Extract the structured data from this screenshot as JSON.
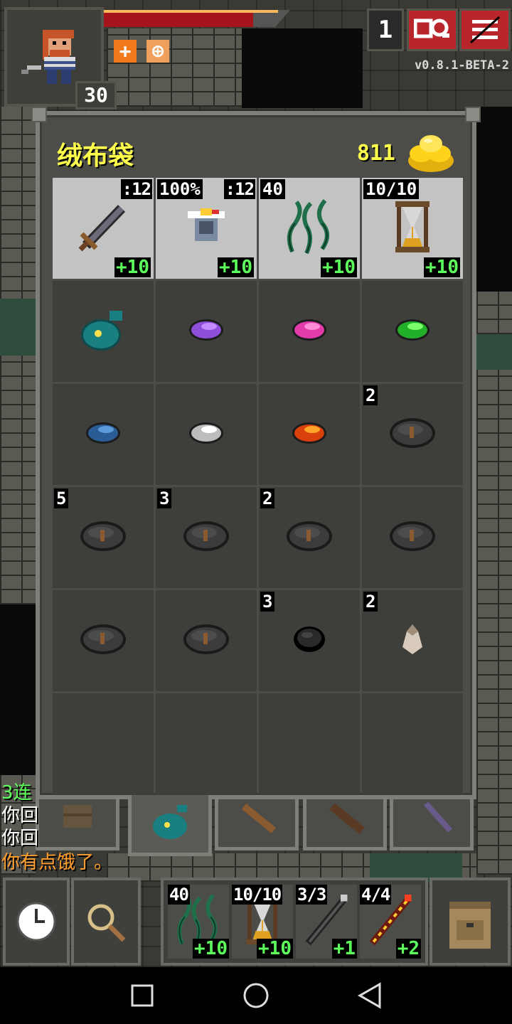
{
  "hud": {
    "depth": "30",
    "level_count": "1",
    "version": "v0.8.1-BETA-2",
    "buffs": [
      "plus-buff",
      "target-buff"
    ]
  },
  "bag": {
    "title": "绒布袋",
    "gold": "811",
    "slots": [
      {
        "icon": "sword",
        "tr": ":12",
        "br": "+10",
        "equipped": true
      },
      {
        "icon": "armor",
        "tl": "100%",
        "tr": ":12",
        "br": "+10",
        "equipped": true
      },
      {
        "icon": "vine-artifact",
        "tl": "40",
        "br": "+10",
        "equipped": true
      },
      {
        "icon": "hourglass",
        "tl": "10/10",
        "br": "+10",
        "equipped": true
      },
      {
        "icon": "velvet-pouch"
      },
      {
        "icon": "purple-seed"
      },
      {
        "icon": "pink-seed"
      },
      {
        "icon": "green-seed"
      },
      {
        "icon": "blue-seed"
      },
      {
        "icon": "white-seed"
      },
      {
        "icon": "orange-seed"
      },
      {
        "icon": "runestone",
        "tl": "2"
      },
      {
        "icon": "runestone",
        "tl": "5"
      },
      {
        "icon": "runestone",
        "tl": "3"
      },
      {
        "icon": "runestone",
        "tl": "2"
      },
      {
        "icon": "runestone"
      },
      {
        "icon": "runestone"
      },
      {
        "icon": "runestone"
      },
      {
        "icon": "black-stone",
        "tl": "3"
      },
      {
        "icon": "bone-idol",
        "tl": "2"
      },
      {},
      {},
      {},
      {}
    ]
  },
  "log": [
    {
      "text": "3连",
      "color": "#5dff5d"
    },
    {
      "text": "你回",
      "color": "#ffffff"
    },
    {
      "text": "你回",
      "color": "#ffffff"
    },
    {
      "text": "你有点饿了。",
      "color": "#ff9e2c"
    }
  ],
  "quickslots": [
    {
      "icon": "vine-artifact",
      "tl": "40",
      "br": "+10"
    },
    {
      "icon": "hourglass",
      "tl": "10/10",
      "br": "+10"
    },
    {
      "icon": "wand-dark",
      "tl": "3/3",
      "br": "+1"
    },
    {
      "icon": "wand-fire",
      "tl": "4/4",
      "br": "+2"
    }
  ],
  "colors": {
    "hp": "#a5141a",
    "gold": "#ffff4c",
    "upgrade": "#5dff5d",
    "danger_button": "#b8252a"
  }
}
